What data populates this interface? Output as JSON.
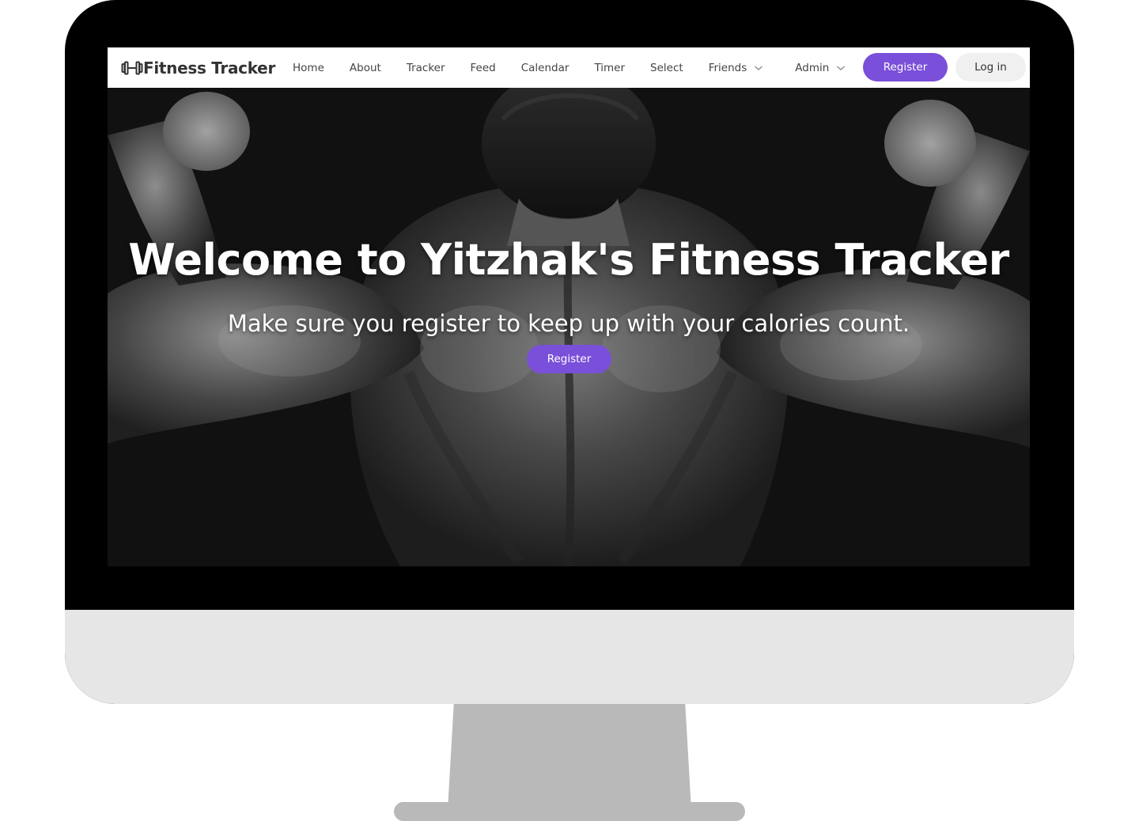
{
  "brand": {
    "icon": "dumbbell-icon",
    "name": "Fitness Tracker"
  },
  "nav": {
    "items": [
      {
        "label": "Home"
      },
      {
        "label": "About"
      },
      {
        "label": "Tracker"
      },
      {
        "label": "Feed"
      },
      {
        "label": "Calendar"
      },
      {
        "label": "Timer"
      },
      {
        "label": "Select"
      },
      {
        "label": "Friends",
        "dropdown": true
      },
      {
        "label": "Admin",
        "dropdown": true
      }
    ],
    "register_label": "Register",
    "login_label": "Log in"
  },
  "hero": {
    "title": "Welcome to Yitzhak's Fitness Tracker",
    "subtitle": "Make sure you register to keep up with your calories count.",
    "cta_label": "Register"
  },
  "colors": {
    "accent": "#7a4fd9",
    "nav_bg": "#ffffff",
    "monitor_bezel": "#000000",
    "monitor_chin": "#e6e6e6",
    "stand": "#b9b9b9"
  }
}
